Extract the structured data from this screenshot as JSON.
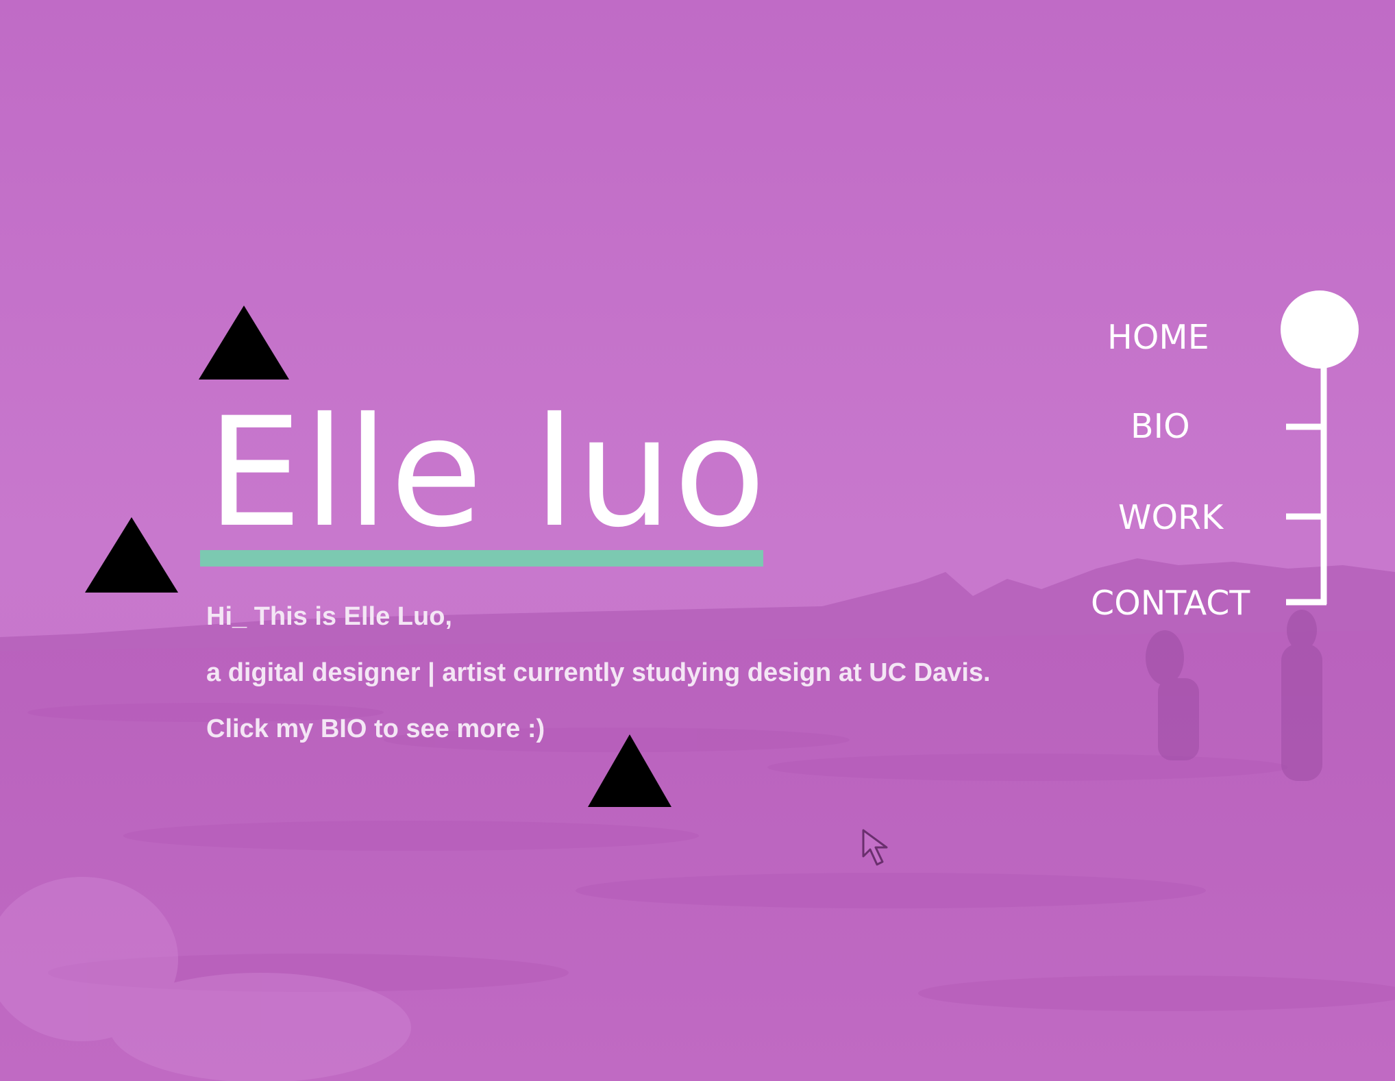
{
  "brand": {
    "name": "Elle luo",
    "accent_color": "#7cc9b1",
    "overlay_color": "#c470c8"
  },
  "intro": {
    "line1": "Hi_ This is Elle Luo,",
    "line2": "a digital designer | artist currently studying design at UC Davis.",
    "line3": "Click my BIO to see more :)"
  },
  "nav": {
    "home": "HOME",
    "bio": "BIO",
    "work": "WORK",
    "contact": "CONTACT",
    "active": "HOME"
  },
  "icons": {
    "decorations": [
      "triangle-icon",
      "triangle-icon",
      "triangle-icon"
    ],
    "pointer": "mouse-cursor-icon",
    "active_marker": "circle-icon"
  }
}
